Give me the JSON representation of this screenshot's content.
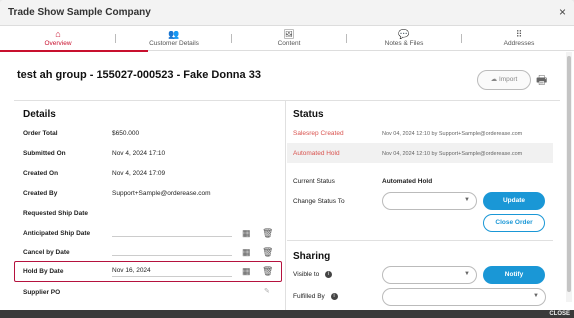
{
  "window": {
    "title": "Trade Show Sample Company",
    "close_glyph": "×"
  },
  "tabs": [
    {
      "label": "Overview",
      "icon": "home-icon",
      "glyph": "⌂",
      "active": true
    },
    {
      "label": "Customer Details",
      "icon": "users-icon",
      "glyph": "👥"
    },
    {
      "label": "Content",
      "icon": "image-icon",
      "glyph": "🖼"
    },
    {
      "label": "Notes & Files",
      "icon": "comment-icon",
      "glyph": "💬"
    },
    {
      "label": "Addresses",
      "icon": "grid-icon",
      "glyph": "⠿"
    }
  ],
  "header": {
    "title": "test ah group - 155027-000523 - Fake Donna 33",
    "import_label": "Import",
    "print_glyph": "🖶"
  },
  "details": {
    "heading": "Details",
    "rows": [
      {
        "label": "Order Total",
        "value": "$650.000"
      },
      {
        "label": "Submitted On",
        "value": "Nov 4, 2024 17:10"
      },
      {
        "label": "Created On",
        "value": "Nov 4, 2024 17:09"
      },
      {
        "label": "Created By",
        "value": "Support+Sample@orderease.com"
      },
      {
        "label": "Requested Ship Date",
        "value": ""
      },
      {
        "label": "Anticipated Ship Date",
        "value": ""
      },
      {
        "label": "Cancel by Date",
        "value": ""
      },
      {
        "label": "Hold By Date",
        "value": "Nov 16, 2024"
      },
      {
        "label": "Supplier PO",
        "value": ""
      }
    ]
  },
  "status": {
    "heading": "Status",
    "history": [
      {
        "label": "Salesrep Created",
        "meta": "Nov 04, 2024 12:10 by Support+Sample@orderease.com"
      },
      {
        "label": "Automated Hold",
        "meta": "Nov 04, 2024 12:10 by Support+Sample@orderease.com"
      }
    ],
    "current_label": "Current Status",
    "current_value": "Automated Hold",
    "change_label": "Change Status To",
    "change_value": "",
    "update_label": "Update",
    "close_order_label": "Close Order"
  },
  "sharing": {
    "heading": "Sharing",
    "visible_to_label": "Visible to",
    "visible_to_value": "",
    "notify_label": "Notify",
    "fulfilled_by_label": "Fulfilled By",
    "fulfilled_by_value": ""
  },
  "footer": {
    "close_label": "CLOSE"
  },
  "colors": {
    "accent": "#c8102e",
    "primary_button": "#1a97d6",
    "status_red": "#d9534f"
  }
}
